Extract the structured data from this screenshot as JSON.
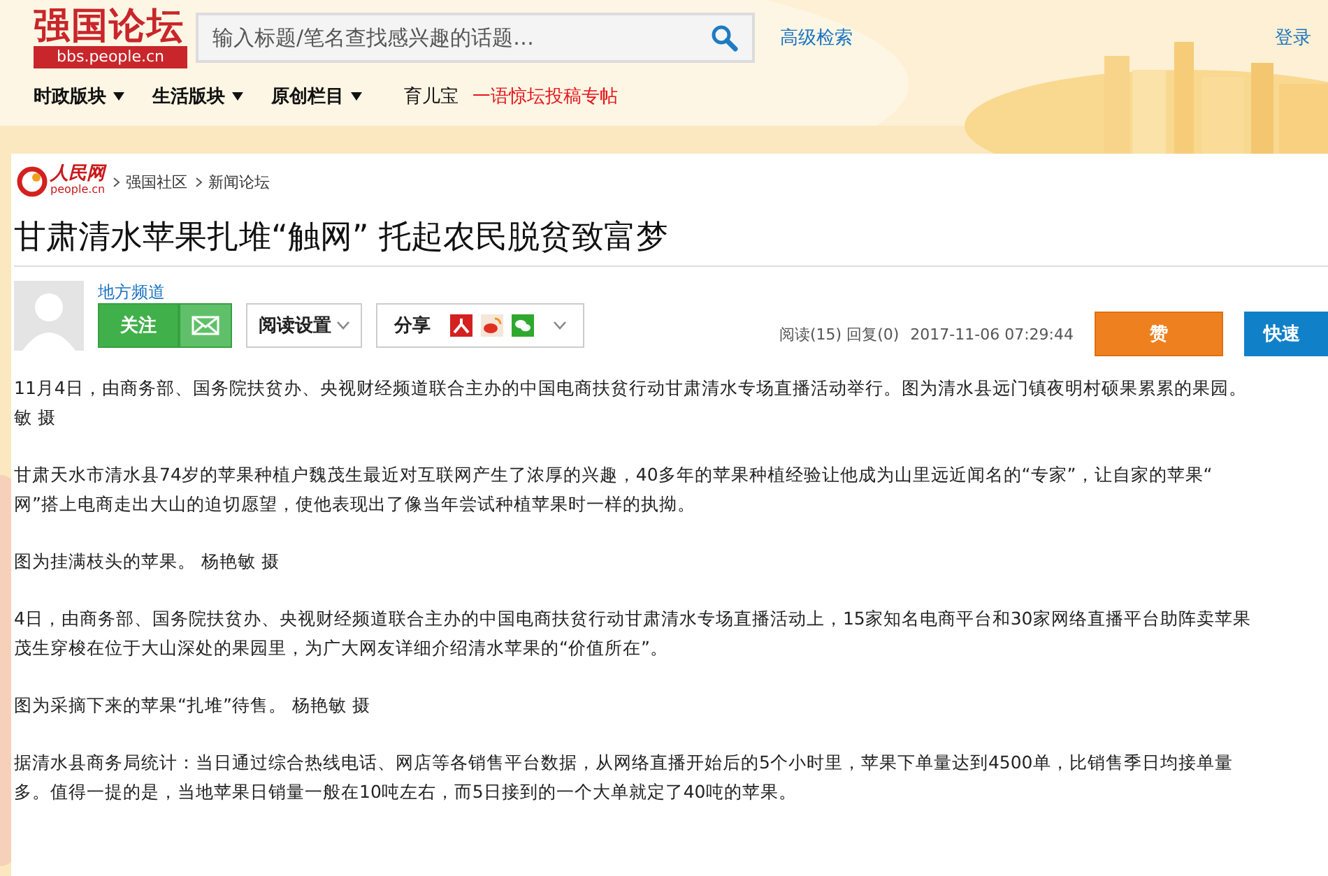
{
  "header": {
    "logo": {
      "title": "强国论坛",
      "domain": "bbs.people.cn"
    },
    "search": {
      "placeholder": "输入标题/笔名查找感兴趣的话题…"
    },
    "advanced_search": "高级检索",
    "login": "登录",
    "nav": [
      {
        "label": "时政版块",
        "kind": "dropdown"
      },
      {
        "label": "生活版块",
        "kind": "dropdown"
      },
      {
        "label": "原创栏目",
        "kind": "dropdown"
      },
      {
        "label": "育儿宝",
        "kind": "link"
      },
      {
        "label": "一语惊坛投稿专帖",
        "kind": "highlight"
      }
    ]
  },
  "breadcrumb": {
    "logo": {
      "name": "人民网",
      "domain": "people.cn"
    },
    "items": [
      "强国社区",
      "新闻论坛"
    ]
  },
  "article": {
    "title": "甘肃清水苹果扎堆“触网” 托起农民脱贫致富梦",
    "author": "地方频道",
    "follow": "关注",
    "reading_settings": "阅读设置",
    "share": "分享",
    "stats": "阅读(15) 回复(0)",
    "time": "2017-11-06 07:29:44",
    "like": "赞",
    "quick_reply": "快速",
    "paragraphs": [
      [
        "11月4日，由商务部、国务院扶贫办、央视财经频道联合主办的中国电商扶贫行动甘肃清水专场直播活动举行。图为清水县远门镇夜明村硕果累累的果园。",
        "敏 摄"
      ],
      [
        "甘肃天水市清水县74岁的苹果种植户魏茂生最近对互联网产生了浓厚的兴趣，40多年的苹果种植经验让他成为山里远近闻名的“专家”，让自家的苹果“",
        "网”搭上电商走出大山的迫切愿望，使他表现出了像当年尝试种植苹果时一样的执拗。"
      ],
      [
        "图为挂满枝头的苹果。 杨艳敏 摄"
      ],
      [
        "4日，由商务部、国务院扶贫办、央视财经频道联合主办的中国电商扶贫行动甘肃清水专场直播活动上，15家知名电商平台和30家网络直播平台助阵卖苹果",
        "茂生穿梭在位于大山深处的果园里，为广大网友详细介绍清水苹果的“价值所在”。"
      ],
      [
        "图为采摘下来的苹果“扎堆”待售。 杨艳敏 摄"
      ],
      [
        "据清水县商务局统计：当日通过综合热线电话、网店等各销售平台数据，从网络直播开始后的5个小时里，苹果下单量达到4500单，比销售季日均接单量",
        "多。值得一提的是，当地苹果日销量一般在10吨左右，而5日接到的一个大单就定了40吨的苹果。"
      ]
    ]
  }
}
